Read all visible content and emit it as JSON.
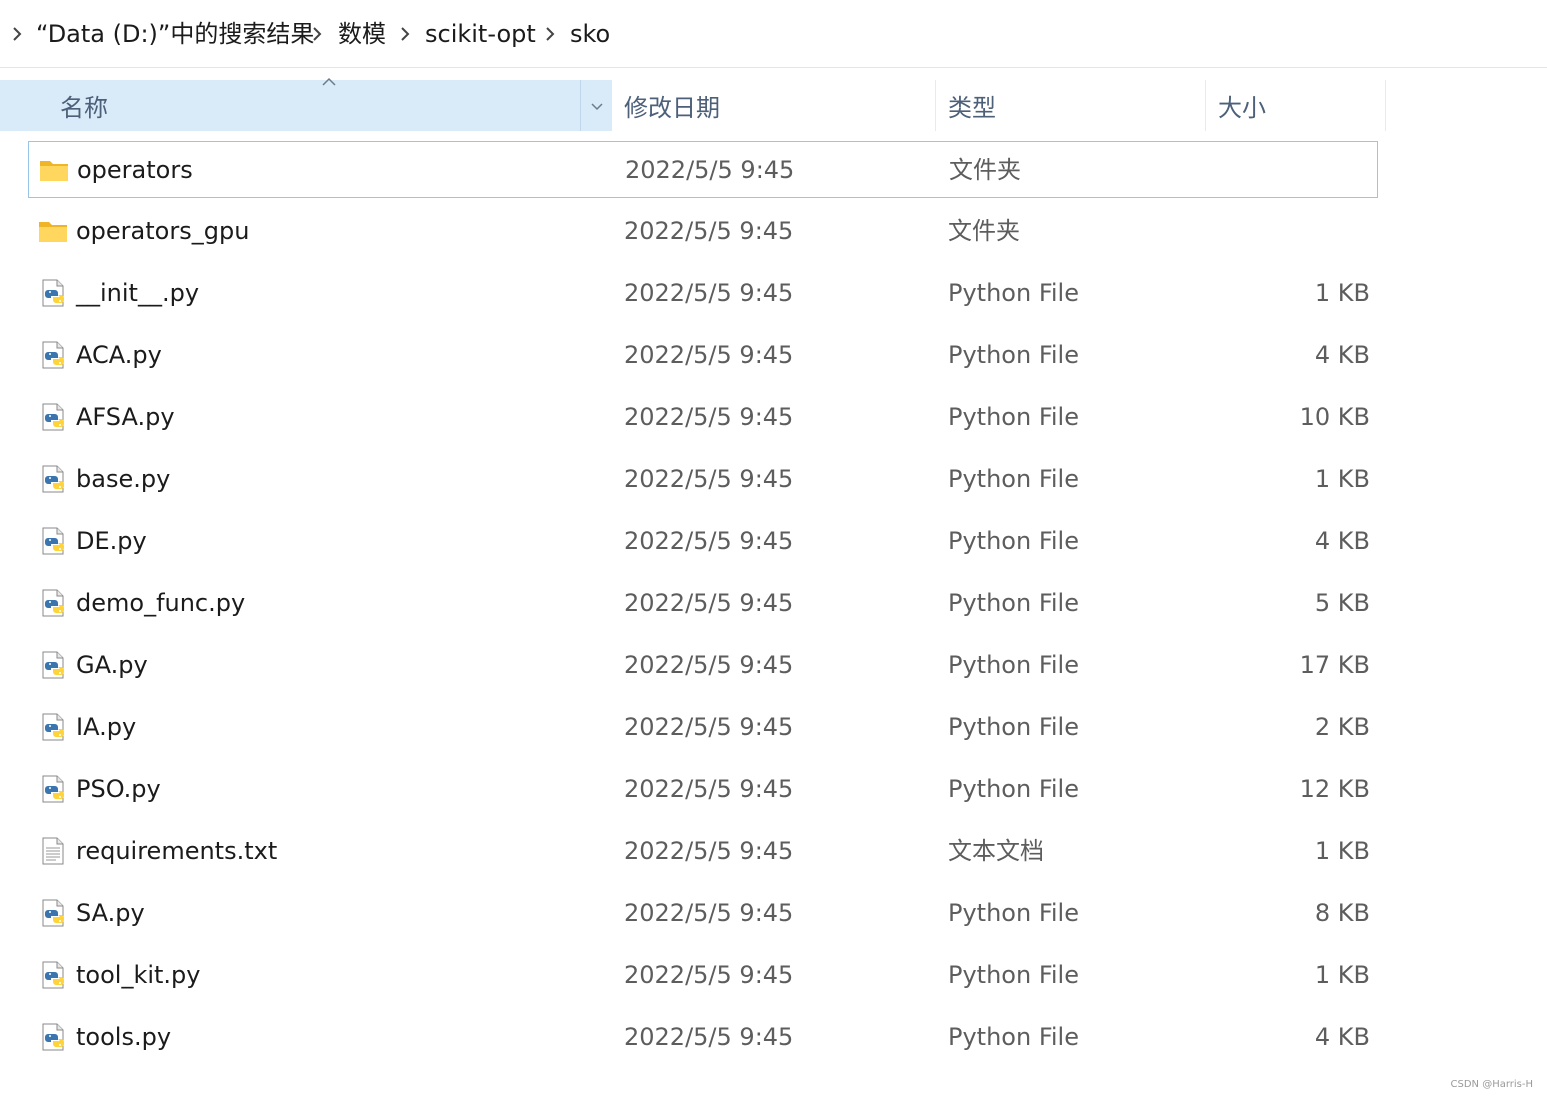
{
  "breadcrumb": {
    "items": [
      {
        "label": "“Data (D:)”中的搜索结果"
      },
      {
        "label": "数模"
      },
      {
        "label": "scikit-opt"
      },
      {
        "label": "sko"
      }
    ]
  },
  "columns": {
    "name": "名称",
    "date": "修改日期",
    "type": "类型",
    "size": "大小"
  },
  "files": [
    {
      "name": "operators",
      "date": "2022/5/5 9:45",
      "type": "文件夹",
      "size": "",
      "icon": "folder-icon",
      "selected": true
    },
    {
      "name": "operators_gpu",
      "date": "2022/5/5 9:45",
      "type": "文件夹",
      "size": "",
      "icon": "folder-icon"
    },
    {
      "name": "__init__.py",
      "date": "2022/5/5 9:45",
      "type": "Python File",
      "size": "1 KB",
      "icon": "python-file-icon"
    },
    {
      "name": "ACA.py",
      "date": "2022/5/5 9:45",
      "type": "Python File",
      "size": "4 KB",
      "icon": "python-file-icon"
    },
    {
      "name": "AFSA.py",
      "date": "2022/5/5 9:45",
      "type": "Python File",
      "size": "10 KB",
      "icon": "python-file-icon"
    },
    {
      "name": "base.py",
      "date": "2022/5/5 9:45",
      "type": "Python File",
      "size": "1 KB",
      "icon": "python-file-icon"
    },
    {
      "name": "DE.py",
      "date": "2022/5/5 9:45",
      "type": "Python File",
      "size": "4 KB",
      "icon": "python-file-icon"
    },
    {
      "name": "demo_func.py",
      "date": "2022/5/5 9:45",
      "type": "Python File",
      "size": "5 KB",
      "icon": "python-file-icon"
    },
    {
      "name": "GA.py",
      "date": "2022/5/5 9:45",
      "type": "Python File",
      "size": "17 KB",
      "icon": "python-file-icon"
    },
    {
      "name": "IA.py",
      "date": "2022/5/5 9:45",
      "type": "Python File",
      "size": "2 KB",
      "icon": "python-file-icon"
    },
    {
      "name": "PSO.py",
      "date": "2022/5/5 9:45",
      "type": "Python File",
      "size": "12 KB",
      "icon": "python-file-icon"
    },
    {
      "name": "requirements.txt",
      "date": "2022/5/5 9:45",
      "type": "文本文档",
      "size": "1 KB",
      "icon": "text-file-icon"
    },
    {
      "name": "SA.py",
      "date": "2022/5/5 9:45",
      "type": "Python File",
      "size": "8 KB",
      "icon": "python-file-icon"
    },
    {
      "name": "tool_kit.py",
      "date": "2022/5/5 9:45",
      "type": "Python File",
      "size": "1 KB",
      "icon": "python-file-icon"
    },
    {
      "name": "tools.py",
      "date": "2022/5/5 9:45",
      "type": "Python File",
      "size": "4 KB",
      "icon": "python-file-icon"
    }
  ],
  "watermark": "CSDN @Harris-H",
  "colors": {
    "header_selected_bg": "#d9ebf9",
    "selection_border": "#99c6e8",
    "folder_yellow": "#ffd75e",
    "python_blue": "#3a75b0",
    "python_yellow": "#ffd43b"
  }
}
